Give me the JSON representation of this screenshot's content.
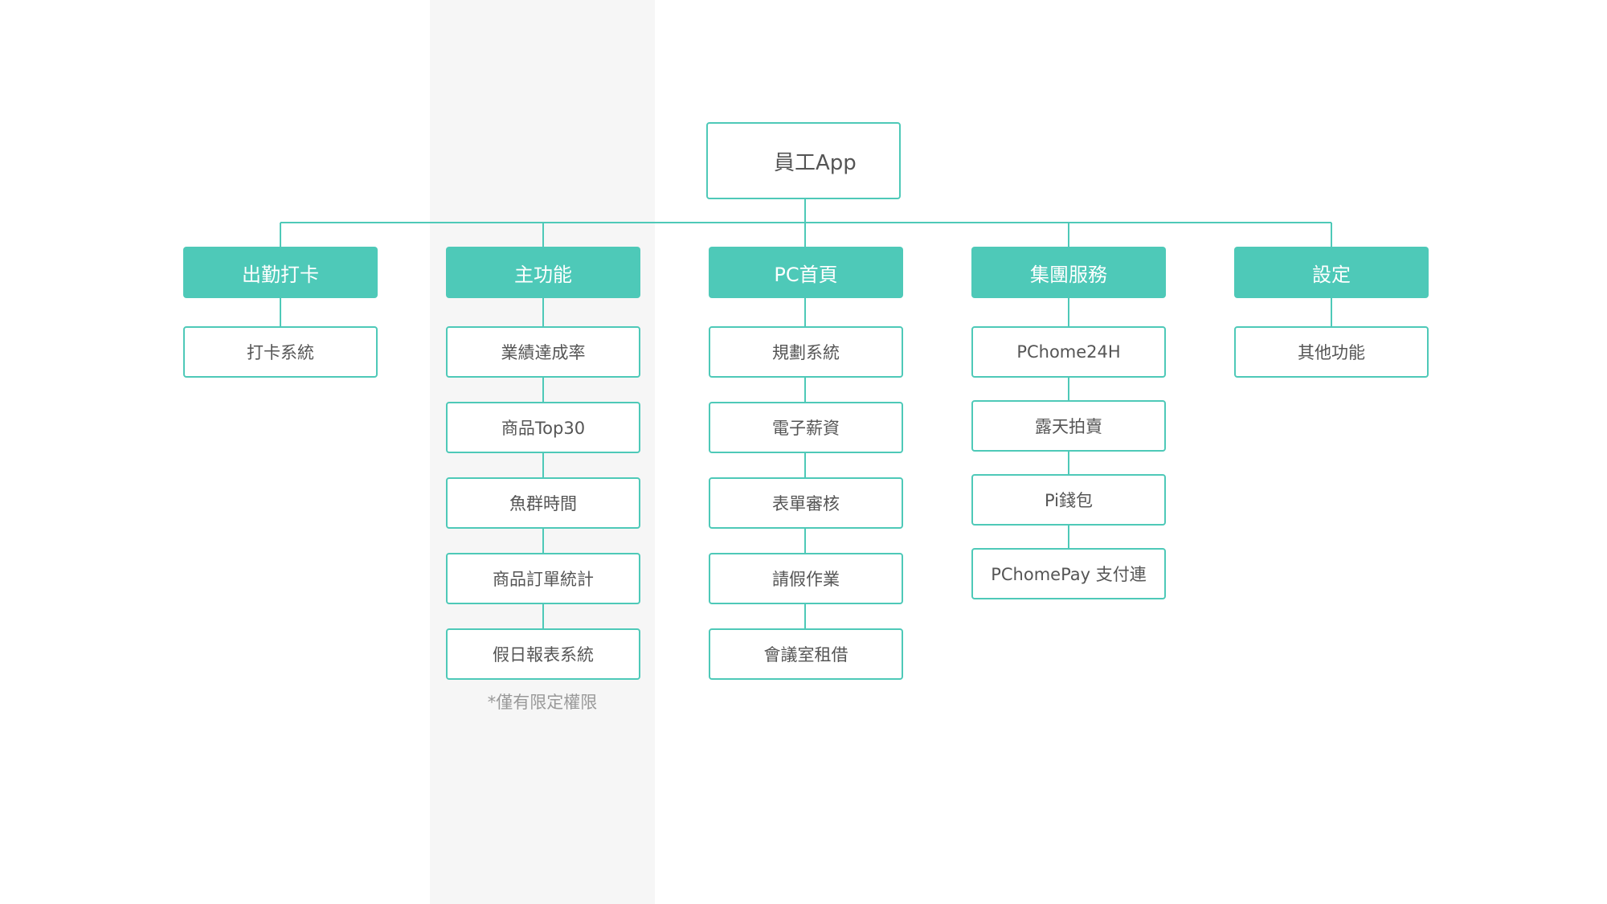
{
  "root": {
    "label": "員工App"
  },
  "columns": [
    {
      "category": "出勤打卡",
      "items": [
        "打卡系統"
      ]
    },
    {
      "category": "主功能",
      "items": [
        "業績達成率",
        "商品Top30",
        "魚群時間",
        "商品訂單統計",
        "假日報表系統"
      ],
      "note": "*僅有限定權限"
    },
    {
      "category": "PC首頁",
      "items": [
        "規劃系統",
        "電子薪資",
        "表單審核",
        "請假作業",
        "會議室租借"
      ]
    },
    {
      "category": "集團服務",
      "items": [
        "PChome24H",
        "露天拍賣",
        "Pi錢包",
        "PChomePay 支付連"
      ]
    },
    {
      "category": "設定",
      "items": [
        "其他功能"
      ]
    }
  ],
  "colors": {
    "accent": "#4ec9b8",
    "band": "#f6f6f6",
    "text": "#555555",
    "note": "#999999"
  }
}
